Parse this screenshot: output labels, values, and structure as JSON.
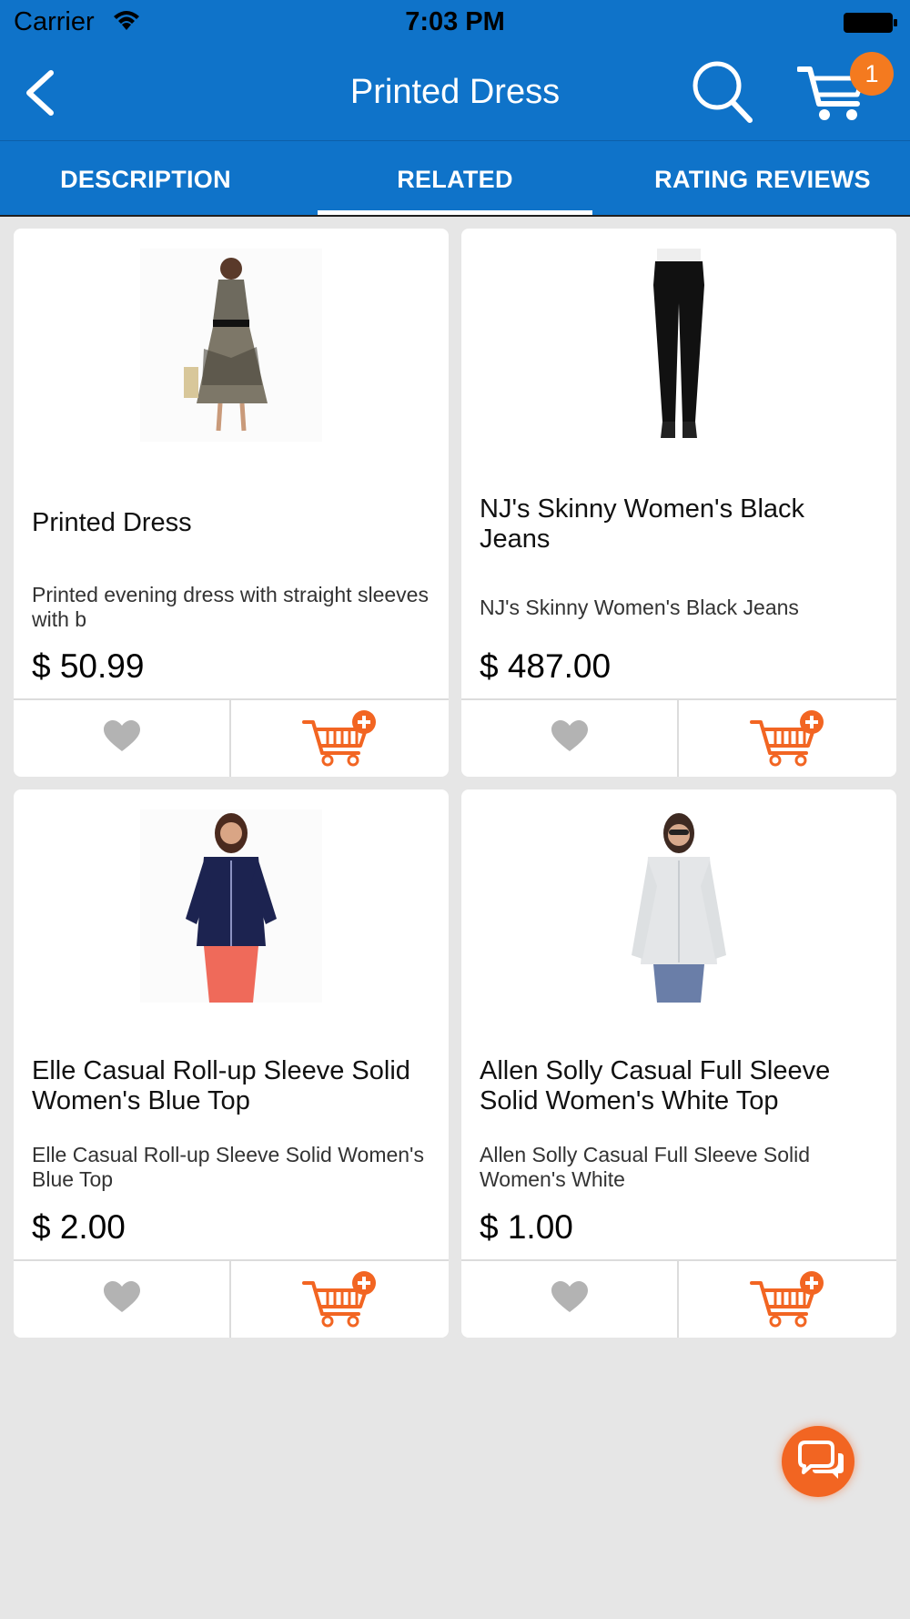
{
  "status_bar": {
    "carrier": "Carrier",
    "time": "7:03 PM"
  },
  "nav": {
    "title": "Printed Dress",
    "cart_count": "1"
  },
  "tabs": [
    {
      "label": "DESCRIPTION",
      "active": false
    },
    {
      "label": "RELATED",
      "active": true
    },
    {
      "label": "RATING REVIEWS",
      "active": false
    }
  ],
  "colors": {
    "header": "#0f73c9",
    "accent": "#f26522",
    "badge": "#f47a1f",
    "heart": "#b3b3b3"
  },
  "products": [
    {
      "name": "Printed Dress",
      "description": "Printed evening dress with straight sleeves with b",
      "price": "$ 50.99",
      "image_icon": "printed-dress-photo"
    },
    {
      "name": "NJ's Skinny Women's Black Jeans",
      "description": "NJ's Skinny Women's Black Jeans",
      "price": "$ 487.00",
      "image_icon": "black-jeans-photo"
    },
    {
      "name": "Elle Casual Roll-up Sleeve Solid Women's Blue Top",
      "description": "Elle Casual Roll-up Sleeve Solid Women's Blue Top",
      "price": "$ 2.00",
      "image_icon": "blue-top-photo"
    },
    {
      "name": "Allen Solly Casual Full Sleeve Solid Women's White Top",
      "description": "Allen Solly Casual Full Sleeve Solid Women's White",
      "price": "$ 1.00",
      "image_icon": "white-top-photo"
    }
  ]
}
